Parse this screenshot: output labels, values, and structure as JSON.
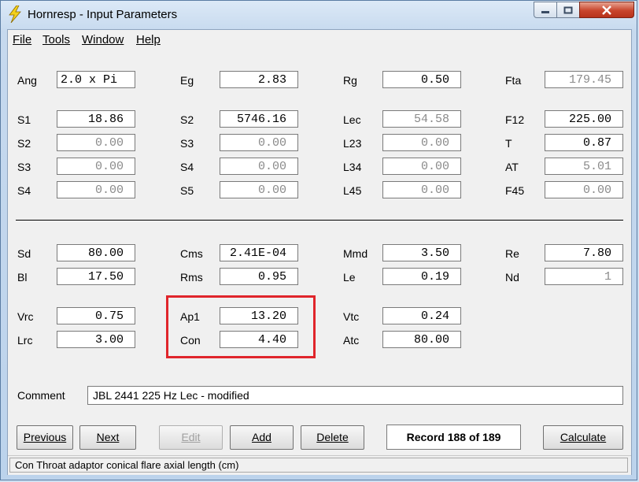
{
  "window": {
    "title": "Hornresp - Input Parameters",
    "accent": "#e0252b"
  },
  "menu": [
    {
      "label": "File"
    },
    {
      "label": "Tools"
    },
    {
      "label": "Window"
    },
    {
      "label": "Help"
    }
  ],
  "fields": [
    {
      "label": "Ang",
      "value": "2.0 x Pi",
      "enabled": true,
      "align": "left"
    },
    {
      "label": "Eg",
      "value": "2.83",
      "enabled": true
    },
    {
      "label": "Rg",
      "value": "0.50",
      "enabled": true
    },
    {
      "label": "Fta",
      "value": "179.45",
      "enabled": false
    },
    {
      "label": "S1",
      "value": "18.86",
      "enabled": true
    },
    {
      "label": "S2",
      "value": "5746.16",
      "enabled": true
    },
    {
      "label": "Lec",
      "value": "54.58",
      "enabled": false
    },
    {
      "label": "F12",
      "value": "225.00",
      "enabled": true
    },
    {
      "label": "S2",
      "value": "0.00",
      "enabled": false
    },
    {
      "label": "S3",
      "value": "0.00",
      "enabled": false
    },
    {
      "label": "L23",
      "value": "0.00",
      "enabled": false
    },
    {
      "label": "T",
      "value": "0.87",
      "enabled": true
    },
    {
      "label": "S3",
      "value": "0.00",
      "enabled": false
    },
    {
      "label": "S4",
      "value": "0.00",
      "enabled": false
    },
    {
      "label": "L34",
      "value": "0.00",
      "enabled": false
    },
    {
      "label": "AT",
      "value": "5.01",
      "enabled": false
    },
    {
      "label": "S4",
      "value": "0.00",
      "enabled": false
    },
    {
      "label": "S5",
      "value": "0.00",
      "enabled": false
    },
    {
      "label": "L45",
      "value": "0.00",
      "enabled": false
    },
    {
      "label": "F45",
      "value": "0.00",
      "enabled": false
    },
    {
      "label": "Sd",
      "value": "80.00",
      "enabled": true
    },
    {
      "label": "Cms",
      "value": "2.41E-04",
      "enabled": true
    },
    {
      "label": "Mmd",
      "value": "3.50",
      "enabled": true
    },
    {
      "label": "Re",
      "value": "7.80",
      "enabled": true
    },
    {
      "label": "Bl",
      "value": "17.50",
      "enabled": true
    },
    {
      "label": "Rms",
      "value": "0.95",
      "enabled": true
    },
    {
      "label": "Le",
      "value": "0.19",
      "enabled": true
    },
    {
      "label": "Nd",
      "value": "1",
      "enabled": false
    },
    {
      "label": "Vrc",
      "value": "0.75",
      "enabled": true
    },
    {
      "label": "Ap1",
      "value": "13.20",
      "enabled": true
    },
    {
      "label": "Vtc",
      "value": "0.24",
      "enabled": true
    },
    {
      "label": "Lrc",
      "value": "3.00",
      "enabled": true
    },
    {
      "label": "Con",
      "value": "4.40",
      "enabled": true
    },
    {
      "label": "Atc",
      "value": "80.00",
      "enabled": true
    }
  ],
  "comment": {
    "label": "Comment",
    "value": "JBL 2441 225 Hz Lec - modified"
  },
  "buttons": {
    "previous": "Previous",
    "next": "Next",
    "edit": "Edit",
    "add": "Add",
    "delete": "Delete",
    "calculate": "Calculate"
  },
  "record": "Record 188 of 189",
  "status": "Con   Throat adaptor conical flare axial length  (cm)"
}
